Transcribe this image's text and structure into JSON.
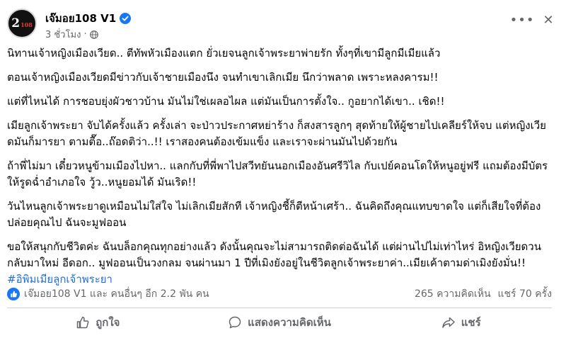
{
  "post": {
    "author": "เจ๊มอย108 V1",
    "time": "3 ชั่วโมง",
    "avatar_text": "2",
    "avatar_small": "108",
    "icons": {
      "verified": "verified-badge-icon",
      "audience": "globe-icon",
      "more": "more-options-icon",
      "close": "close-icon"
    },
    "paragraphs": [
      "นิทานเจ้าหญิงเมืองเวียด.. ตีทัพหัวเมืองแตก ยั่วเยจนลูกเจ้าพระยาพ่ายรัก ทั้งๆที่เขามีลูกมีเมียแล้ว",
      "ตอนเจ้าหญิงเมืองเวียดมีข่าวกับเจ้าชายเมืองนึง จนทำเขาเลิกเมีย นึกว่าพลาด เพราะหลงคารม!!",
      "แต่ที่ไหนได้ การชอบยุ่งผัวชาวบ้าน มันไม่ใช่เผลอไผล แต่มันเป็นการตั้งใจ.. กูอยากได้เขา.. เชิด!!",
      "เมียลูกเจ้าพระยา จับได้ครั้งแล้ว ครั้งเล่า จะป่าวประกาศหย่าร้าง ก็สงสารลูกๆ สุดท้ายให้ผู้ชายไปเคลียร์ให้จบ แต่หญิงเวียดมันก็มารยา ตามตื๊อ..ถ๊อดติว่า..!! เราสองคนต้องเข้มแข็ง และเราจะผ่านมันไปด้วยกัน",
      "ถ้าพี่ไม่มา เดี๋ยวหนูข้ามเมืองไปหา.. แลกกับที่พี่พาไปสวีทยันนอกเมืองอันศรีวิไล กับเปย์คอนโดให้หนูอยู่ฟรี แถมต้องมีบัตรให้รูดฉ่ำอำเภอใจ วู้ว..หนูยอมได้ มันเริด!!",
      "วันไหนลูกเจ้าพระยาดูเหมือนไม่ใส่ใจ ไม่เลิกเมียสักที เจ้าหญิงชี้ก็ตีหน้าเศร้า.. ฉันคิดถึงคุณแทบขาดใจ แต่ก็เสียใจที่ต้องปล่อยคุณไป ฉันจะมูฟออน",
      "ขอให้สนุกกับชีวิตค่ะ ฉันบล็อกคุณทุกอย่างแล้ว ดังนั้นคุณจะไม่สามารถติดต่อฉันได้ แต่ผ่านไปไม่เท่าไหร่ อิหญิงเวียดวนกลับมาใหม่ อีดอก.. มูฟออนเป็นวงกลม จนผ่านมา 1 ปีที่เมิงยังอยู่ในชีวิตลูกเจ้าพระยาค่า..เมียเค้าตามด่าเมิงยังมั่น!!"
    ],
    "hashtag": "#อิพิมเมียลูกเจ้าพระยา"
  },
  "stats": {
    "reactions": "เจ๊มอย108 V1 และ คนอื่นๆ อีก 2.2 พัน คน",
    "comments": "265 ความคิดเห็น",
    "shares": "แชร์ 70 ครั้ง"
  },
  "actions": {
    "like": "ถูกใจ",
    "comment": "แสดงความคิดเห็น",
    "share": "แชร์"
  },
  "colors": {
    "accent": "#1877f2",
    "hashtag": "#216fdb",
    "muted": "#65676b"
  }
}
